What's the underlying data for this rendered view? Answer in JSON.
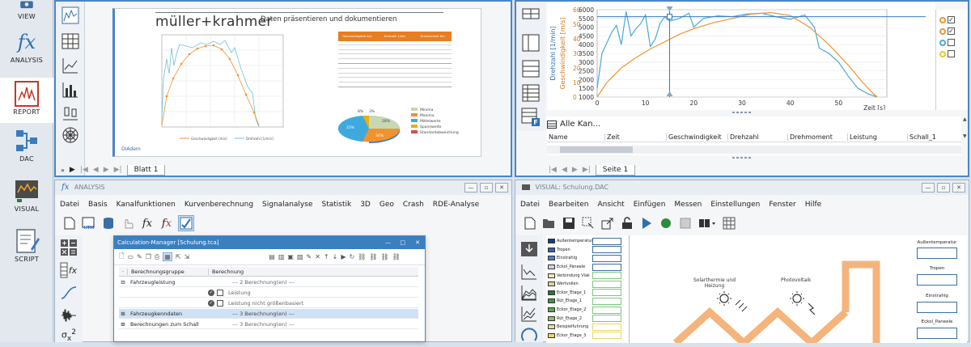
{
  "sidebar": {
    "items": [
      {
        "label": "VIEW",
        "icon": "view-icon"
      },
      {
        "label": "ANALYSIS",
        "icon": "fx-icon"
      },
      {
        "label": "REPORT",
        "icon": "report-icon",
        "active": true
      },
      {
        "label": "DAC",
        "icon": "dac-icon"
      },
      {
        "label": "VISUAL",
        "icon": "visual-icon"
      },
      {
        "label": "SCRIPT",
        "icon": "script-icon"
      }
    ]
  },
  "report": {
    "brand": "müller+krahmer",
    "heading": "Daten präsentieren und dokumentieren",
    "footer_brand": "DIAdem",
    "sheet_tab": "Blatt 1",
    "chart_legend": [
      "Geschwindigkeit [m/s]",
      "Drehzahl [1/min]"
    ],
    "pie_legend": [
      "Minima",
      "Maxima",
      "Mittelwerte",
      "Spannweite",
      "Standardabweichung"
    ],
    "pie_labels": [
      "8%",
      "3%",
      "28%",
      "23%",
      "34%"
    ],
    "table_headers": [
      "Geschwindigkeit m/s",
      "Drehzahl 1/min",
      "Drehmoment Nm"
    ]
  },
  "view": {
    "axis_left_label": "Drehzahl [1/min]",
    "axis_right_label": "Geschwindigkeit [m/s]",
    "x_axis_label": "Zeit [s]",
    "channel_group": "Alle Kan...",
    "columns": [
      "Name",
      "Zeit",
      "Geschwindigkeit",
      "Drehzahl",
      "Drehmoment",
      "Leistung",
      "Schall_1"
    ],
    "sheet_tab": "Seite 1"
  },
  "chart_data": {
    "type": "line",
    "xlabel": "Zeit [s]",
    "ylabel": "Drehzahl [1/min]",
    "y2label": "Geschwindigkeit [m/s]",
    "xlim": [
      0,
      60
    ],
    "ylim": [
      1000,
      6000
    ],
    "x_ticks": [
      0,
      10,
      20,
      30,
      40,
      50
    ],
    "y_ticks": [
      1000,
      1500,
      2000,
      2500,
      3000,
      3500,
      4000,
      4500,
      5000,
      5500,
      6000
    ],
    "y2_ticks": [
      0,
      10,
      20,
      30,
      40,
      50,
      60
    ],
    "cursor_x": 15,
    "series": [
      {
        "name": "Drehzahl",
        "color": "#4aa8d8",
        "x": [
          0,
          1,
          3,
          4,
          5,
          6,
          7,
          8,
          9,
          10,
          11,
          12,
          13,
          14,
          15,
          17,
          19,
          20,
          22,
          25,
          28,
          31,
          34,
          37,
          40,
          43,
          45,
          46,
          48,
          50,
          52,
          54,
          56,
          58
        ],
        "y": [
          1500,
          3500,
          4700,
          5100,
          4000,
          5900,
          4500,
          4900,
          5200,
          5700,
          3900,
          4300,
          5200,
          5600,
          5350,
          5500,
          5800,
          5000,
          5500,
          5650,
          5600,
          5750,
          5800,
          5600,
          5450,
          5700,
          5000,
          3800,
          3500,
          3000,
          2200,
          1500,
          1200,
          1000
        ]
      },
      {
        "name": "Geschwindigkeit",
        "color": "#f0932e",
        "x": [
          0,
          2,
          5,
          8,
          11,
          14,
          17,
          20,
          24,
          28,
          32,
          36,
          40,
          44,
          48,
          52,
          55,
          57,
          58
        ],
        "y": [
          0,
          10,
          20,
          27,
          33,
          38,
          43,
          47,
          51,
          54,
          57,
          58,
          56,
          48,
          36,
          22,
          10,
          3,
          0
        ]
      }
    ]
  },
  "analysis": {
    "title": "ANALYSIS",
    "menu": [
      "Datei",
      "Basis",
      "Kanalfunktionen",
      "Kurvenberechnung",
      "Signalanalyse",
      "Statistik",
      "3D",
      "Geo",
      "Crash",
      "RDE-Analyse"
    ],
    "calc_manager": {
      "title": "Calculation-Manager  [Schulung.tca]",
      "headers": [
        "Berechnungsgruppe",
        "Berechnung"
      ],
      "rows": [
        {
          "group": "Fahrzeugleistung",
          "calc": "--- 2 Berechnung(en) ---",
          "selected": false
        },
        {
          "group": "",
          "calc": "Leistung",
          "selected": false
        },
        {
          "group": "",
          "calc": "Leistung nicht größenbasiert",
          "selected": false
        },
        {
          "group": "Fahrzeugkenndaten",
          "calc": "--- 3 Berechnung(en) ---",
          "selected": true
        },
        {
          "group": "Berechnungen zum Schall",
          "calc": "--- 3 Berechnung(en) ---",
          "selected": false
        }
      ]
    }
  },
  "visual": {
    "title": "VISUAL:  Schulung.DAC",
    "menu": [
      "Datei",
      "Bearbeiten",
      "Ansicht",
      "Einfügen",
      "Messen",
      "Einstellungen",
      "Fenster",
      "Hilfe"
    ],
    "channels": [
      "Außentemperatur",
      "Tropen",
      "Einstrahlg",
      "Eckol_Paneele",
      "Verbindung Vlak",
      "Wertvollen",
      "Eckor_Etage_1",
      "Rüt_Etage_1",
      "Eckor_Etage_2",
      "Rüt_Etage_2",
      "Beispielfuhrung",
      "Eckor_Etage_3"
    ],
    "channel_colors": [
      "#1f3a7a",
      "#3a5fb0",
      "#4a7fd0",
      "#c8d3ee",
      "#efe8b4",
      "#d8d2aa",
      "#2a7a2a",
      "#3a9a3a",
      "#5aa84a",
      "#8ac06a",
      "#e0e0a0",
      "#e8d86a"
    ],
    "right_labels": [
      "Außentemperatur",
      "Tropen",
      "Einstrahlg",
      "Eckol_Paneele"
    ],
    "label_solar": "Solarthermie und Heizung",
    "label_pv": "Photovoltaik"
  }
}
